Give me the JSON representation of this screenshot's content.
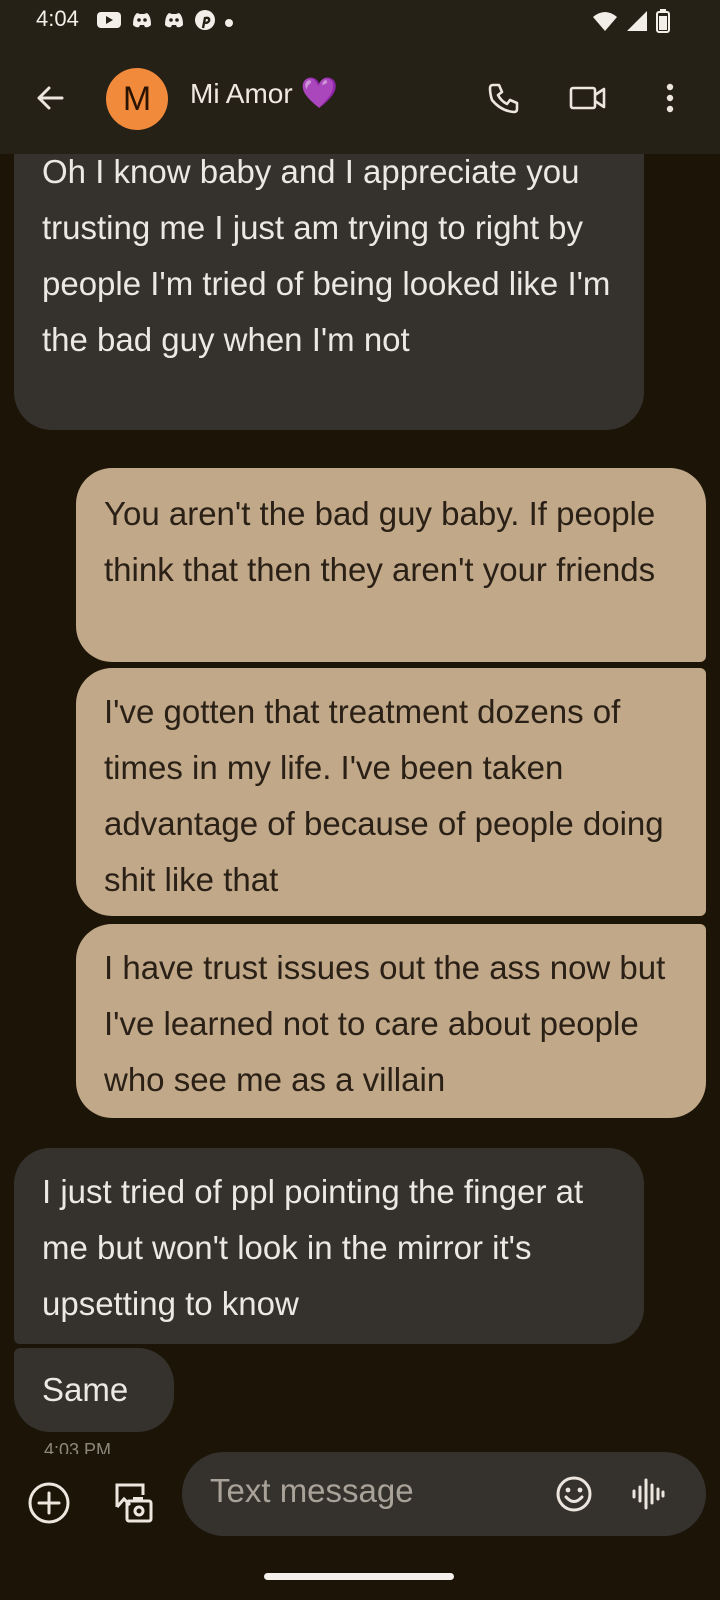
{
  "status_bar": {
    "time": "4:04",
    "left_icons": [
      "youtube-icon",
      "discord-icon",
      "discord-icon",
      "pinterest-icon",
      "dot-icon"
    ],
    "right_icons": [
      "wifi-icon",
      "signal-icon",
      "battery-icon"
    ]
  },
  "header": {
    "avatar_letter": "M",
    "contact_name": "Mi Amor",
    "name_emoji": "💜",
    "actions": [
      "phone-icon",
      "video-call-icon",
      "more-vert-icon"
    ]
  },
  "messages": [
    {
      "direction": "incoming",
      "text": "Oh I know baby and I appreciate you trusting me I just am trying to right by people I'm tried of being looked like I'm the bad guy when I'm not"
    },
    {
      "direction": "outgoing",
      "text": "You aren't the bad guy baby. If people think that then they aren't your friends"
    },
    {
      "direction": "outgoing",
      "text": "I've gotten that treatment dozens of times in my life. I've been taken advantage of because of people doing shit like that"
    },
    {
      "direction": "outgoing",
      "text": "I have trust issues out the ass now but I've learned not to care about people who see me as a villain"
    },
    {
      "direction": "incoming",
      "text": "I just tried of ppl pointing the finger at me but won't look in the mirror it's upsetting to know"
    },
    {
      "direction": "incoming",
      "text": "Same"
    }
  ],
  "timestamp": "4:03 PM",
  "compose": {
    "placeholder": "Text message"
  },
  "colors": {
    "background": "#1b1407",
    "incoming_bubble": "#35322e",
    "outgoing_bubble": "#c0a889",
    "avatar": "#f28a3c",
    "heart": "#9b4fe0"
  }
}
